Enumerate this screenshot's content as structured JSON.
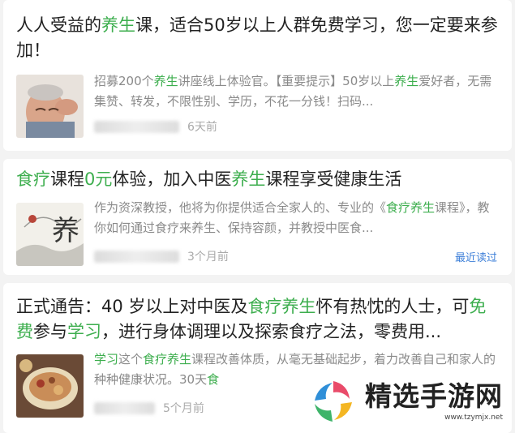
{
  "cards": [
    {
      "title_parts": [
        "人人受益的",
        "养生",
        "课，适合50岁以上人群免费学习，您一定要来参加！"
      ],
      "desc_parts": [
        "招募200个",
        "养生",
        "讲座线上体验官。【重要提示】50岁以上",
        "养生",
        "爱好者，无需集赞、转发，不限性别、学历，不花一分钱！扫码..."
      ],
      "time": "6天前"
    },
    {
      "title_parts": [
        "食疗",
        "课程",
        "0元",
        "体验，加入中医",
        "养生",
        "课程享受健康生活"
      ],
      "desc_parts": [
        "作为资深教授，他将为你提供适合全家人的、专业的《",
        "食疗养生",
        "课程》，教你如何通过食疗来养生、保持容颜，并教授中医食..."
      ],
      "time": "3个月前",
      "recent": "最近读过"
    },
    {
      "title_parts": [
        "正式通告：40 岁以上对中医及",
        "食疗养生",
        "怀有热忱的人士，可",
        "免费",
        "参与",
        "学习",
        "，进行身体调理以及探索食疗之法，零费用..."
      ],
      "desc_parts": [
        "学习",
        "这个",
        "食疗养生",
        "课程改善体质，从毫无基础起步，着力改善自己和家人的种种健康状况。30天",
        "食",
        ""
      ],
      "time": "5个月前"
    }
  ],
  "watermark": {
    "name": "精选手游网",
    "url": "www.tzymjx.net"
  },
  "colors": {
    "highlight": "#3dae4e",
    "link": "#3b7ed8",
    "muted": "#8a8a8a"
  }
}
